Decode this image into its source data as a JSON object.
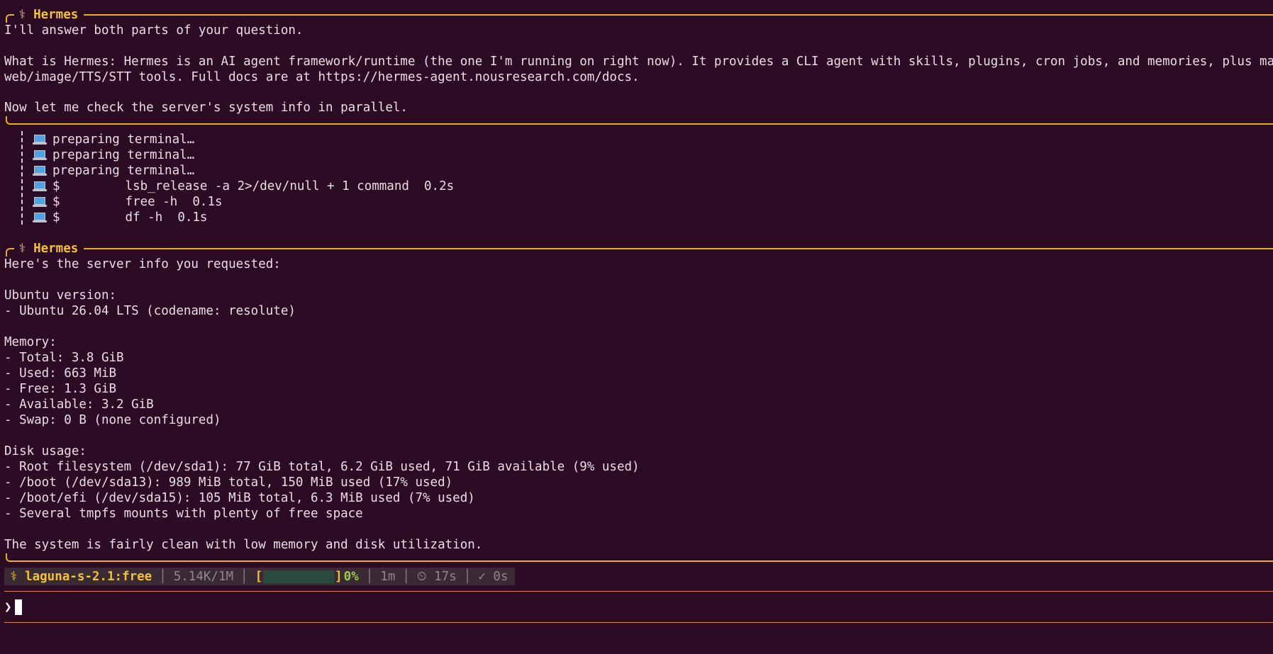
{
  "messages": [
    {
      "author": "⚕ Hermes",
      "lines": [
        "I'll answer both parts of your question.",
        "",
        "What is Hermes: Hermes is an AI agent framework/runtime (the one I'm running on right now). It provides a CLI agent with skills, plugins, cron jobs, and memories, plus managed",
        "web/image/TTS/STT tools. Full docs are at https://hermes-agent.nousresearch.com/docs.",
        "",
        "Now let me check the server's system info in parallel."
      ]
    },
    {
      "author": "⚕ Hermes",
      "lines": [
        "Here's the server info you requested:",
        "",
        "Ubuntu version:",
        "- Ubuntu 26.04 LTS (codename: resolute)",
        "",
        "Memory:",
        "- Total: 3.8 GiB",
        "- Used: 663 MiB",
        "- Free: 1.3 GiB",
        "- Available: 3.2 GiB",
        "- Swap: 0 B (none configured)",
        "",
        "Disk usage:",
        "- Root filesystem (/dev/sda1): 77 GiB total, 6.2 GiB used, 71 GiB available (9% used)",
        "- /boot (/dev/sda13): 989 MiB total, 150 MiB used (17% used)",
        "- /boot/efi (/dev/sda15): 105 MiB total, 6.3 MiB used (7% used)",
        "- Several tmpfs mounts with plenty of free space",
        "",
        "The system is fairly clean with low memory and disk utilization."
      ]
    }
  ],
  "tool_calls": [
    {
      "icon": "laptop-icon",
      "prefix": "preparing terminal…",
      "command": "",
      "duration": ""
    },
    {
      "icon": "laptop-icon",
      "prefix": "preparing terminal…",
      "command": "",
      "duration": ""
    },
    {
      "icon": "laptop-icon",
      "prefix": "preparing terminal…",
      "command": "",
      "duration": ""
    },
    {
      "icon": "laptop-icon",
      "prefix": "$",
      "command": "lsb_release -a 2>/dev/null + 1 command",
      "duration": "0.2s"
    },
    {
      "icon": "laptop-icon",
      "prefix": "$",
      "command": "free -h",
      "duration": "0.1s"
    },
    {
      "icon": "laptop-icon",
      "prefix": "$",
      "command": "df -h",
      "duration": "0.1s"
    }
  ],
  "status_bar": {
    "model": "⚕ laguna-s-2.1:free",
    "tokens": "5.14K/1M",
    "context_open": "[",
    "context_close": "]",
    "context_fraction": 0.0,
    "context_percent": "0%",
    "elapsed": "1m",
    "timer": "⏲ 17s",
    "last": "✓ 0s"
  },
  "prompt": {
    "symbol": "❯",
    "value": ""
  },
  "colors": {
    "background": "#2c0b24",
    "accent": "#f1c232",
    "text": "#e9dde6",
    "rule": "#d68a57"
  }
}
